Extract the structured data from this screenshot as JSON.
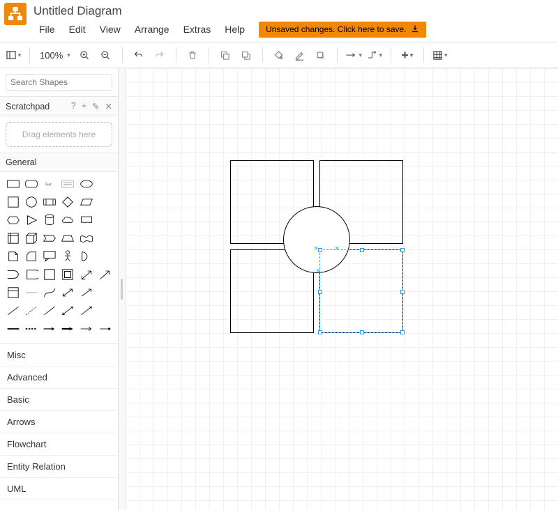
{
  "header": {
    "doc_title": "Untitled Diagram",
    "menus": [
      "File",
      "Edit",
      "View",
      "Arrange",
      "Extras",
      "Help"
    ],
    "save_banner": "Unsaved changes. Click here to save."
  },
  "toolbar": {
    "zoom": "100%"
  },
  "sidebar": {
    "search_placeholder": "Search Shapes",
    "scratchpad_label": "Scratchpad",
    "scratchpad_hint": "Drag elements here",
    "general_label": "General",
    "categories": [
      "Misc",
      "Advanced",
      "Basic",
      "Arrows",
      "Flowchart",
      "Entity Relation",
      "UML"
    ]
  },
  "icons": {
    "view_mode": "view-mode",
    "zoom_in": "zoom-in",
    "zoom_out": "zoom-out",
    "undo": "undo",
    "redo": "redo",
    "delete": "delete",
    "to_front": "to-front",
    "to_back": "to-back",
    "fill": "fill",
    "stroke": "stroke",
    "shadow": "shadow",
    "connection": "connection",
    "waypoints": "waypoints",
    "insert": "insert",
    "table": "table"
  },
  "colors": {
    "accent": "#f08705",
    "selection": "#1da1f2"
  }
}
